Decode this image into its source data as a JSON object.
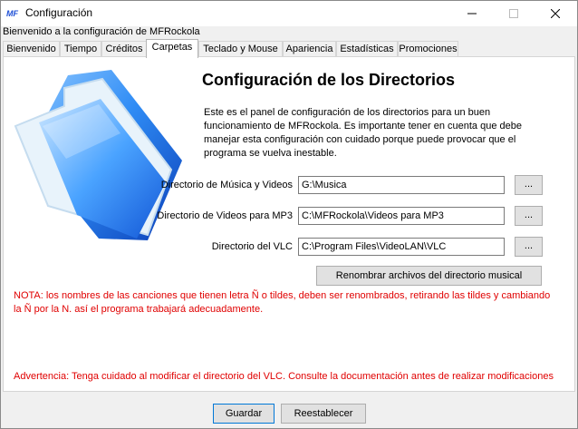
{
  "window": {
    "title": "Configuración"
  },
  "subtitle": "Bienvenido a la configuración de MFRockola",
  "tabs": [
    {
      "label": "Bienvenido"
    },
    {
      "label": "Tiempo"
    },
    {
      "label": "Créditos"
    },
    {
      "label": "Carpetas"
    },
    {
      "label": "Teclado y Mouse"
    },
    {
      "label": "Apariencia"
    },
    {
      "label": "Estadísticas"
    },
    {
      "label": "Promociones"
    }
  ],
  "active_tab": "Carpetas",
  "heading": "Configuración de los Directorios",
  "description": "Este es el panel de configuración de los directorios para un buen funcionamiento de MFRockola. Es importante tener en cuenta que debe manejar esta configuración con cuidado porque puede provocar que el programa se vuelva inestable.",
  "directories": [
    {
      "label": "Directorio de Música y Videos",
      "value": "G:\\Musica",
      "browse": "..."
    },
    {
      "label": "Directorio de Videos para MP3",
      "value": "C:\\MFRockola\\Videos para MP3",
      "browse": "..."
    },
    {
      "label": "Directorio del VLC",
      "value": "C:\\Program Files\\VideoLAN\\VLC",
      "browse": "..."
    }
  ],
  "rename_button": "Renombrar archivos del directorio musical",
  "note": "NOTA: los nombres de las canciones que tienen letra Ñ o tildes, deben ser renombrados, retirando las tildes y cambiando la Ñ por la N. así el programa trabajará adecuadamente.",
  "warning": "Advertencia: Tenga cuidado al modificar el directorio del VLC. Consulte la documentación antes de realizar modificaciones",
  "footer": {
    "save": "Guardar",
    "reset": "Reestablecer"
  },
  "colors": {
    "note_text": "#e00000",
    "folder_blue": "#1e73e6"
  }
}
